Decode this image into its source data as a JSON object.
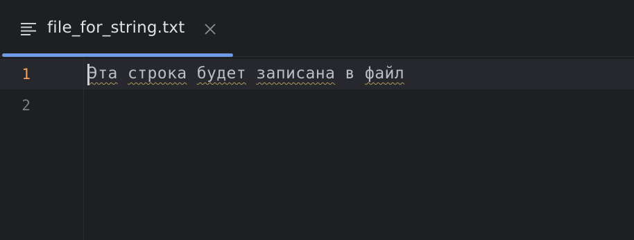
{
  "tab": {
    "title": "file_for_string.txt",
    "icon": "text-file-icon",
    "close_icon": "close-icon",
    "active_underline_color": "#6f9ae6"
  },
  "editor": {
    "lines": [
      {
        "number": "1",
        "words": [
          "Эта",
          " ",
          "строка",
          " ",
          "будет",
          " ",
          "записана",
          " ",
          "в",
          " ",
          "файл"
        ],
        "current": true
      },
      {
        "number": "2",
        "words": [],
        "current": false
      }
    ],
    "line_number_active_color": "#f2a25c",
    "line_number_color": "#7c7f87",
    "text_color": "#bcbec4",
    "background": "#1e1f22"
  }
}
